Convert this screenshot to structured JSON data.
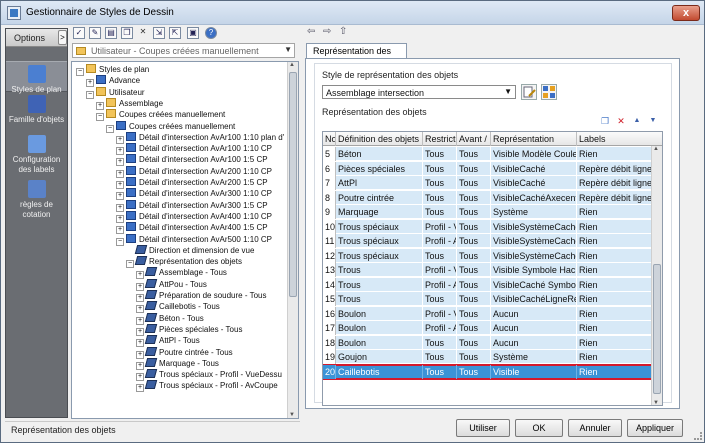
{
  "window": {
    "title": "Gestionnaire de Styles de Dessin",
    "close_glyph": "x"
  },
  "left_panel": {
    "options_label": "Options",
    "options_btn": ">",
    "items": [
      {
        "label": "Styles de plan",
        "icon": "styles-plan-icon",
        "selected": true
      },
      {
        "label": "Famille d'objets",
        "icon": "famille-objets-icon",
        "selected": false
      },
      {
        "label": "Configuration des labels",
        "icon": "labels-config-icon",
        "selected": false
      },
      {
        "label": "règles de cotation",
        "icon": "cotation-rules-icon",
        "selected": false
      }
    ]
  },
  "toolbar": {
    "buttons": [
      "new-icon",
      "edit-icon",
      "copy-icon",
      "paste-icon",
      "delete-icon",
      "import-icon",
      "export-icon",
      "purge-icon",
      "help-icon"
    ],
    "glyphs": [
      "✓",
      "✎",
      "▤",
      "❐",
      "✕",
      "⇲",
      "⇱",
      "▣",
      "?"
    ],
    "nav_glyphs": [
      "⇦",
      "⇨",
      "⇧"
    ]
  },
  "filter_combo": {
    "value": "Utilisateur - Coupes créées manuellement",
    "arrow": "▼"
  },
  "tree": [
    {
      "label": "Styles de plan",
      "level": 0,
      "icon": "fold",
      "exp": "−"
    },
    {
      "label": "Advance",
      "level": 1,
      "icon": "blue",
      "exp": "+"
    },
    {
      "label": "Utilisateur",
      "level": 1,
      "icon": "fold",
      "exp": "−"
    },
    {
      "label": "Assemblage",
      "level": 2,
      "icon": "fold",
      "exp": "+"
    },
    {
      "label": "Coupes créées manuellement",
      "level": 2,
      "icon": "fold",
      "exp": "−"
    },
    {
      "label": "Coupes créées manuellement",
      "level": 3,
      "icon": "blue",
      "exp": "−"
    },
    {
      "label": "Détail d'intersection AvAr100 1:10 plan d'",
      "level": 4,
      "icon": "blue",
      "exp": "+"
    },
    {
      "label": "Détail d'intersection AvAr100 1:10 CP",
      "level": 4,
      "icon": "blue",
      "exp": "+"
    },
    {
      "label": "Détail d'intersection AvAr100 1:5 CP",
      "level": 4,
      "icon": "blue",
      "exp": "+"
    },
    {
      "label": "Détail d'intersection AvAr200 1:10 CP",
      "level": 4,
      "icon": "blue",
      "exp": "+"
    },
    {
      "label": "Détail d'intersection AvAr200 1:5 CP",
      "level": 4,
      "icon": "blue",
      "exp": "+"
    },
    {
      "label": "Détail d'intersection AvAr300 1:10 CP",
      "level": 4,
      "icon": "blue",
      "exp": "+"
    },
    {
      "label": "Détail d'intersection AvAr300 1:5 CP",
      "level": 4,
      "icon": "blue",
      "exp": "+"
    },
    {
      "label": "Détail d'intersection AvAr400 1:10 CP",
      "level": 4,
      "icon": "blue",
      "exp": "+"
    },
    {
      "label": "Détail d'intersection AvAr400 1:5 CP",
      "level": 4,
      "icon": "blue",
      "exp": "+"
    },
    {
      "label": "Détail d'intersection AvAr500 1:10 CP",
      "level": 4,
      "icon": "blue",
      "exp": "−"
    },
    {
      "label": "Direction et dimension de vue",
      "level": 5,
      "icon": "dim",
      "exp": ""
    },
    {
      "label": "Représentation des objets",
      "level": 5,
      "icon": "dim",
      "exp": "−"
    },
    {
      "label": "Assemblage - Tous",
      "level": 6,
      "icon": "dim",
      "exp": "+"
    },
    {
      "label": "AttPou - Tous",
      "level": 6,
      "icon": "dim",
      "exp": "+"
    },
    {
      "label": "Préparation de soudure - Tous",
      "level": 6,
      "icon": "dim",
      "exp": "+"
    },
    {
      "label": "Caillebotis - Tous",
      "level": 6,
      "icon": "dim",
      "exp": "+"
    },
    {
      "label": "Béton - Tous",
      "level": 6,
      "icon": "dim",
      "exp": "+"
    },
    {
      "label": "Pièces spéciales - Tous",
      "level": 6,
      "icon": "dim",
      "exp": "+"
    },
    {
      "label": "AttPl - Tous",
      "level": 6,
      "icon": "dim",
      "exp": "+"
    },
    {
      "label": "Poutre cintrée - Tous",
      "level": 6,
      "icon": "dim",
      "exp": "+"
    },
    {
      "label": "Marquage - Tous",
      "level": 6,
      "icon": "dim",
      "exp": "+"
    },
    {
      "label": "Trous spéciaux - Profil - VueDessu",
      "level": 6,
      "icon": "dim",
      "exp": "+"
    },
    {
      "label": "Trous spéciaux - Profil - AvCoupe",
      "level": 6,
      "icon": "dim",
      "exp": "+"
    }
  ],
  "tab": {
    "label": "Représentation des objets"
  },
  "style_section": {
    "label": "Style de représentation des objets",
    "value": "Assemblage intersection",
    "arrow": "▼"
  },
  "table_section": {
    "label": "Représentation des objets",
    "action_glyphs": [
      "❐",
      "✕",
      "▲",
      "▼"
    ],
    "columns": [
      "No",
      "Définition des objets",
      "Restricti",
      "Avant /",
      "Représentation",
      "Labels"
    ],
    "rows": [
      {
        "no": "5",
        "def": "Béton",
        "restr": "Tous",
        "avant": "Tous",
        "repr": "Visible Modèle Couleu",
        "labels": "Rien"
      },
      {
        "no": "6",
        "def": "Pièces spéciales",
        "restr": "Tous",
        "avant": "Tous",
        "repr": "VisibleCaché",
        "labels": "Repère débit ligne de"
      },
      {
        "no": "7",
        "def": "AttPl",
        "restr": "Tous",
        "avant": "Tous",
        "repr": "VisibleCaché",
        "labels": "Repère débit ligne de"
      },
      {
        "no": "8",
        "def": "Poutre cintrée",
        "restr": "Tous",
        "avant": "Tous",
        "repr": "VisibleCachéAxecentra",
        "labels": "Repère débit ligne de"
      },
      {
        "no": "9",
        "def": "Marquage",
        "restr": "Tous",
        "avant": "Tous",
        "repr": "Système",
        "labels": "Rien"
      },
      {
        "no": "10",
        "def": "Trous spéciaux",
        "restr": "Profil - V",
        "avant": "Tous",
        "repr": "VisibleSystèmeCaché",
        "labels": "Rien"
      },
      {
        "no": "11",
        "def": "Trous spéciaux",
        "restr": "Profil - A",
        "avant": "Tous",
        "repr": "VisibleSystèmeCaché",
        "labels": "Rien"
      },
      {
        "no": "12",
        "def": "Trous spéciaux",
        "restr": "Tous",
        "avant": "Tous",
        "repr": "VisibleSystèmeCaché",
        "labels": "Rien"
      },
      {
        "no": "13",
        "def": "Trous",
        "restr": "Profil - V",
        "avant": "Tous",
        "repr": "Visible Symbole Hach",
        "labels": "Rien"
      },
      {
        "no": "14",
        "def": "Trous",
        "restr": "Profil - A",
        "avant": "Tous",
        "repr": "VisibleCaché Symbole",
        "labels": "Rien"
      },
      {
        "no": "15",
        "def": "Trous",
        "restr": "Tous",
        "avant": "Tous",
        "repr": "VisibleCachéLigneRef",
        "labels": "Rien"
      },
      {
        "no": "16",
        "def": "Boulon",
        "restr": "Profil - V",
        "avant": "Tous",
        "repr": "Aucun",
        "labels": "Rien"
      },
      {
        "no": "17",
        "def": "Boulon",
        "restr": "Profil - A",
        "avant": "Tous",
        "repr": "Aucun",
        "labels": "Rien"
      },
      {
        "no": "18",
        "def": "Boulon",
        "restr": "Tous",
        "avant": "Tous",
        "repr": "Aucun",
        "labels": "Rien"
      },
      {
        "no": "19",
        "def": "Goujon",
        "restr": "Tous",
        "avant": "Tous",
        "repr": "Système",
        "labels": "Rien"
      },
      {
        "no": "20",
        "def": "Caillebotis",
        "restr": "Tous",
        "avant": "Tous",
        "repr": "Visible",
        "labels": "Rien",
        "selected": true
      }
    ]
  },
  "status": {
    "text": "Représentation des objets"
  },
  "buttons": {
    "use": "Utiliser",
    "ok": "OK",
    "cancel": "Annuler",
    "apply": "Appliquer"
  },
  "colors": {
    "selection": "#3b93d7",
    "highlight_border": "#d4192c",
    "row_bg": "#d7e9f7"
  }
}
